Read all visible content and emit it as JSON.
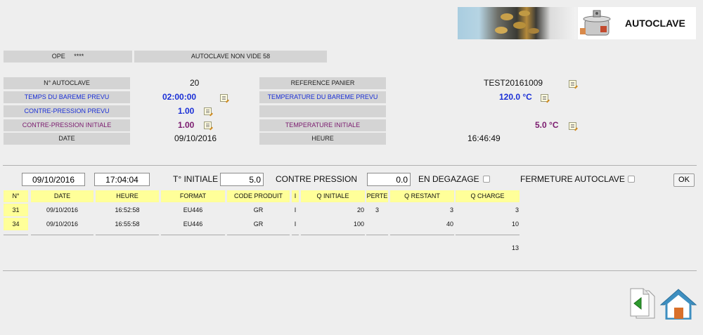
{
  "header": {
    "title": "AUTOCLAVE"
  },
  "top_bar": {
    "ope_label": "OPE",
    "ope_value": "****",
    "status": "AUTOCLAVE NON VIDE 58"
  },
  "info": {
    "autoclave_no_label": "N° AUTOCLAVE",
    "autoclave_no_value": "20",
    "temps_bareme_label": "TEMPS DU BAREME PREVU",
    "temps_bareme_value": "02:00:00",
    "contre_pression_prevu_label": "CONTRE-PRESSION PREVU",
    "contre_pression_prevu_value": "1.00",
    "contre_pression_initiale_label": "CONTRE-PRESSION INITIALE",
    "contre_pression_initiale_value": "1.00",
    "date_label": "DATE",
    "date_value": "09/10/2016",
    "reference_panier_label": "REFERENCE PANIER",
    "reference_panier_value": "TEST20161009",
    "temperature_bareme_label": "TEMPERATURE DU BAREME PREVU",
    "temperature_bareme_value": "120.0 °C",
    "temperature_initiale_label": "TEMPERATURE INITIALE",
    "temperature_initiale_value": "5.0 °C",
    "heure_label": "HEURE",
    "heure_value": "16:46:49"
  },
  "form": {
    "date_value": "09/10/2016",
    "time_value": "17:04:04",
    "t_initiale_label": "T° INITIALE",
    "t_initiale_value": "5.0",
    "contre_pression_label": "CONTRE PRESSION",
    "contre_pression_value": "0.0",
    "en_degazage_label": "EN DEGAZAGE",
    "fermeture_label": "FERMETURE AUTOCLAVE",
    "ok_label": "OK"
  },
  "table": {
    "headers": [
      "N°",
      "DATE",
      "HEURE",
      "FORMAT",
      "CODE PRODUIT",
      "I",
      "Q INITIALE",
      "PERTE",
      "Q RESTANT",
      "Q CHARGE"
    ],
    "rows": [
      {
        "no": "31",
        "date": "09/10/2016",
        "heure": "16:52:58",
        "format": "EU446",
        "code": "GR",
        "i": "I",
        "q_initiale": "20",
        "perte": "3",
        "q_restant": "3",
        "q_charge": "3"
      },
      {
        "no": "34",
        "date": "09/10/2016",
        "heure": "16:55:58",
        "format": "EU446",
        "code": "GR",
        "i": "I",
        "q_initiale": "100",
        "perte": "",
        "q_restant": "40",
        "q_charge": "10"
      }
    ],
    "total_charge": "13"
  },
  "colors": {
    "blue_text": "#1a2fd6",
    "purple_text": "#7a1a6e",
    "label_bg": "#d4d4d4",
    "table_header_bg": "#ffff99",
    "home_icon": "#3e8fc0",
    "back_arrow": "#2e9a2e"
  },
  "icons": {
    "edit": "edit-note-icon",
    "back": "back-page-icon",
    "home": "home-icon"
  }
}
